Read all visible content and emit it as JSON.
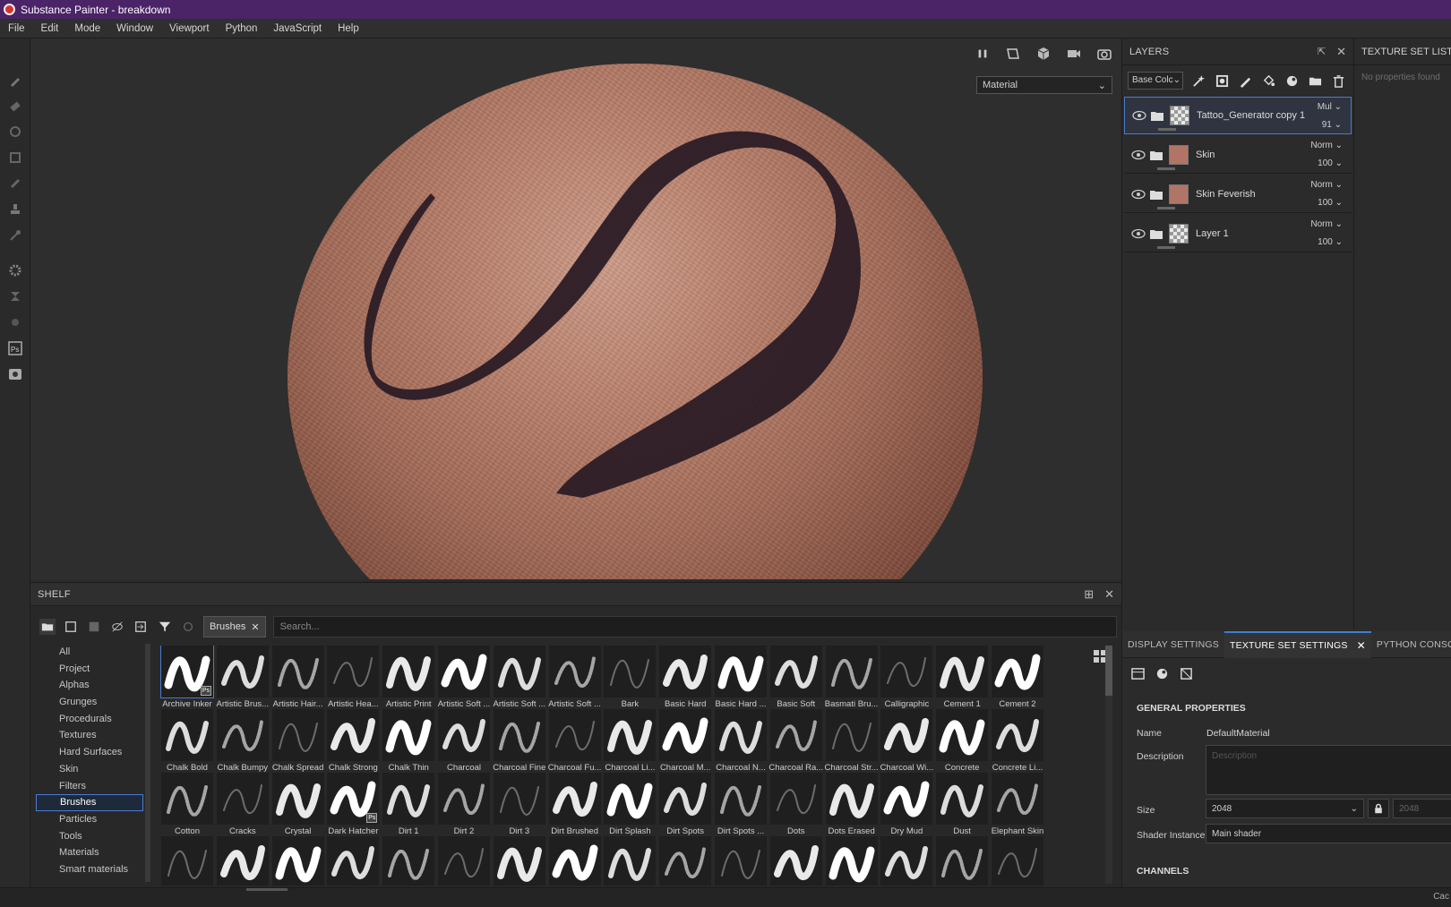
{
  "window": {
    "title": "Substance Painter - breakdown"
  },
  "menu": [
    "File",
    "Edit",
    "Mode",
    "Window",
    "Viewport",
    "Python",
    "JavaScript",
    "Help"
  ],
  "viewport": {
    "material_mode": "Material"
  },
  "shelf": {
    "title": "SHELF",
    "categories": [
      "All",
      "Project",
      "Alphas",
      "Grunges",
      "Procedurals",
      "Textures",
      "Hard Surfaces",
      "Skin",
      "Filters",
      "Brushes",
      "Particles",
      "Tools",
      "Materials",
      "Smart materials"
    ],
    "selected_category": "Brushes",
    "filter_chip": "Brushes",
    "search_placeholder": "Search...",
    "brushes": [
      [
        "Archive Inker",
        "Artistic Brus...",
        "Artistic Hair...",
        "Artistic Hea...",
        "Artistic Print",
        "Artistic Soft ...",
        "Artistic Soft ...",
        "Artistic Soft ...",
        "Bark",
        "Basic Hard",
        "Basic Hard ...",
        "Basic Soft",
        "Basmati Bru...",
        "Calligraphic",
        "Cement 1",
        "Cement 2"
      ],
      [
        "Chalk Bold",
        "Chalk Bumpy",
        "Chalk Spread",
        "Chalk Strong",
        "Chalk Thin",
        "Charcoal",
        "Charcoal Fine",
        "Charcoal Fu...",
        "Charcoal Li...",
        "Charcoal M...",
        "Charcoal N...",
        "Charcoal Ra...",
        "Charcoal Str...",
        "Charcoal Wi...",
        "Concrete",
        "Concrete Li..."
      ],
      [
        "Cotton",
        "Cracks",
        "Crystal",
        "Dark Hatcher",
        "Dirt 1",
        "Dirt 2",
        "Dirt 3",
        "Dirt Brushed",
        "Dirt Splash",
        "Dirt Spots",
        "Dirt Spots ...",
        "Dots",
        "Dots Erased",
        "Dry Mud",
        "Dust",
        "Elephant Skin"
      ],
      [
        "",
        "",
        "",
        "",
        "",
        "",
        "",
        "",
        "",
        "",
        "",
        "",
        "",
        "",
        "",
        ""
      ]
    ],
    "ps_badge": "Ps"
  },
  "layers": {
    "title": "LAYERS",
    "channel": "Base Colc",
    "items": [
      {
        "name": "Tattoo_Generator copy 1",
        "blend": "Mul",
        "opacity": "91",
        "thumb": "checker",
        "selected": true
      },
      {
        "name": "Skin",
        "blend": "Norm",
        "opacity": "100",
        "thumb": "skin",
        "selected": false
      },
      {
        "name": "Skin Feverish",
        "blend": "Norm",
        "opacity": "100",
        "thumb": "skin",
        "selected": false
      },
      {
        "name": "Layer 1",
        "blend": "Norm",
        "opacity": "100",
        "thumb": "checker",
        "selected": false
      }
    ]
  },
  "texture_set_list": {
    "title": "TEXTURE SET LIST",
    "empty": "No properties found"
  },
  "properties": {
    "tabs": [
      "DISPLAY SETTINGS",
      "TEXTURE SET SETTINGS",
      "PYTHON CONSOLE"
    ],
    "active_tab": "TEXTURE SET SETTINGS",
    "general_title": "GENERAL PROPERTIES",
    "name_label": "Name",
    "name_value": "DefaultMaterial",
    "description_label": "Description",
    "description_placeholder": "Description",
    "size_label": "Size",
    "size_value": "2048",
    "size_value2": "2048",
    "shader_label": "Shader Instance",
    "shader_value": "Main shader",
    "channels_title": "CHANNELS"
  },
  "status": {
    "right": "Cac"
  },
  "colors": {
    "title_bar": "#4b2367",
    "accent": "#4a7bd0",
    "tattoo": "#2c1c26"
  }
}
